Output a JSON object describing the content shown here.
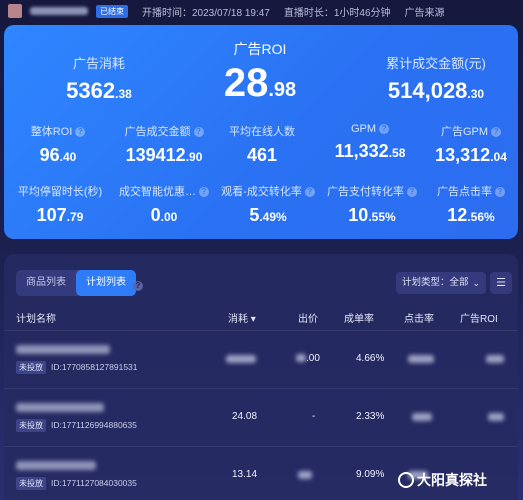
{
  "topbar": {
    "status_badge": "已结束",
    "start_time": "开播时间：2023/07/18 19:47",
    "duration": "直播时长：1小时46分钟",
    "source": "广告来源"
  },
  "stats": {
    "ad_spend": {
      "label": "广告消耗",
      "int": "5362",
      "dec": ".38"
    },
    "ad_roi": {
      "label": "广告ROI",
      "int": "28",
      "dec": ".98"
    },
    "gmv_total": {
      "label": "累计成交金额(元)",
      "int": "514,028",
      "dec": ".30"
    },
    "overall_roi": {
      "label": "整体ROI",
      "int": "96",
      "dec": ".40"
    },
    "ad_gmv": {
      "label": "广告成交金额",
      "int": "139412",
      "dec": ".90"
    },
    "avg_online": {
      "label": "平均在线人数",
      "int": "461",
      "dec": ""
    },
    "gpm": {
      "label": "GPM",
      "int": "11,332",
      "dec": ".58"
    },
    "ad_gpm": {
      "label": "广告GPM",
      "int": "13,312",
      "dec": ".04"
    },
    "avg_stay": {
      "label": "平均停留时长(秒)",
      "int": "107",
      "dec": ".79"
    },
    "smart_discount": {
      "label": "成交智能优惠…",
      "int": "0",
      "dec": ".00"
    },
    "watch_conv": {
      "label": "观看-成交转化率",
      "int": "5",
      "dec": ".49%"
    },
    "ad_pay_conv": {
      "label": "广告支付转化率",
      "int": "10",
      "dec": ".55%"
    },
    "ad_ctr": {
      "label": "广告点击率",
      "int": "12",
      "dec": ".56%"
    }
  },
  "panel": {
    "tabs": [
      "商品列表",
      "计划列表"
    ],
    "active_tab": 1,
    "plan_type_select": "计划类型：全部",
    "columns": [
      "计划名称",
      "消耗",
      "出价",
      "成单率",
      "点击率",
      "广告ROI"
    ],
    "rows": [
      {
        "status": "未投放",
        "id": "ID:1770858127891531",
        "spend": "",
        "bid": ".00",
        "order_rate": "4.66%",
        "ctr": "",
        "roi": ""
      },
      {
        "status": "未投放",
        "id": "ID:1771126994880635",
        "spend": "24.08",
        "bid": "-",
        "order_rate": "2.33%",
        "ctr": "",
        "roi": ""
      },
      {
        "status": "未投放",
        "id": "ID:1771127084030035",
        "spend": "13.14",
        "bid": "",
        "order_rate": "9.09%",
        "ctr": "",
        "roi": ""
      }
    ]
  },
  "watermark": "大阳真探社"
}
